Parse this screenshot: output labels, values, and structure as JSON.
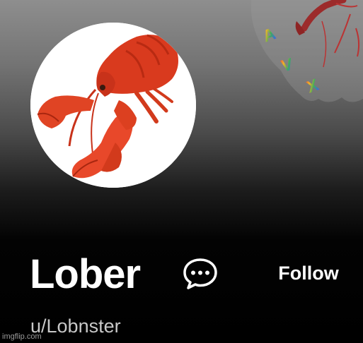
{
  "profile": {
    "display_name": "Lober",
    "username": "u/Lobnster",
    "follow_label": "Follow",
    "chat_icon": "chat-bubble-ellipsis-icon",
    "avatar": "lobster-photo",
    "banner_letters": [
      "A",
      "V",
      "X"
    ]
  },
  "watermark": "imgflip.com",
  "colors": {
    "background_top": "#8e8e8e",
    "background_bottom": "#000000",
    "text_primary": "#ffffff",
    "text_secondary": "#c8c8c8",
    "lobster_red": "#d93a1e"
  }
}
